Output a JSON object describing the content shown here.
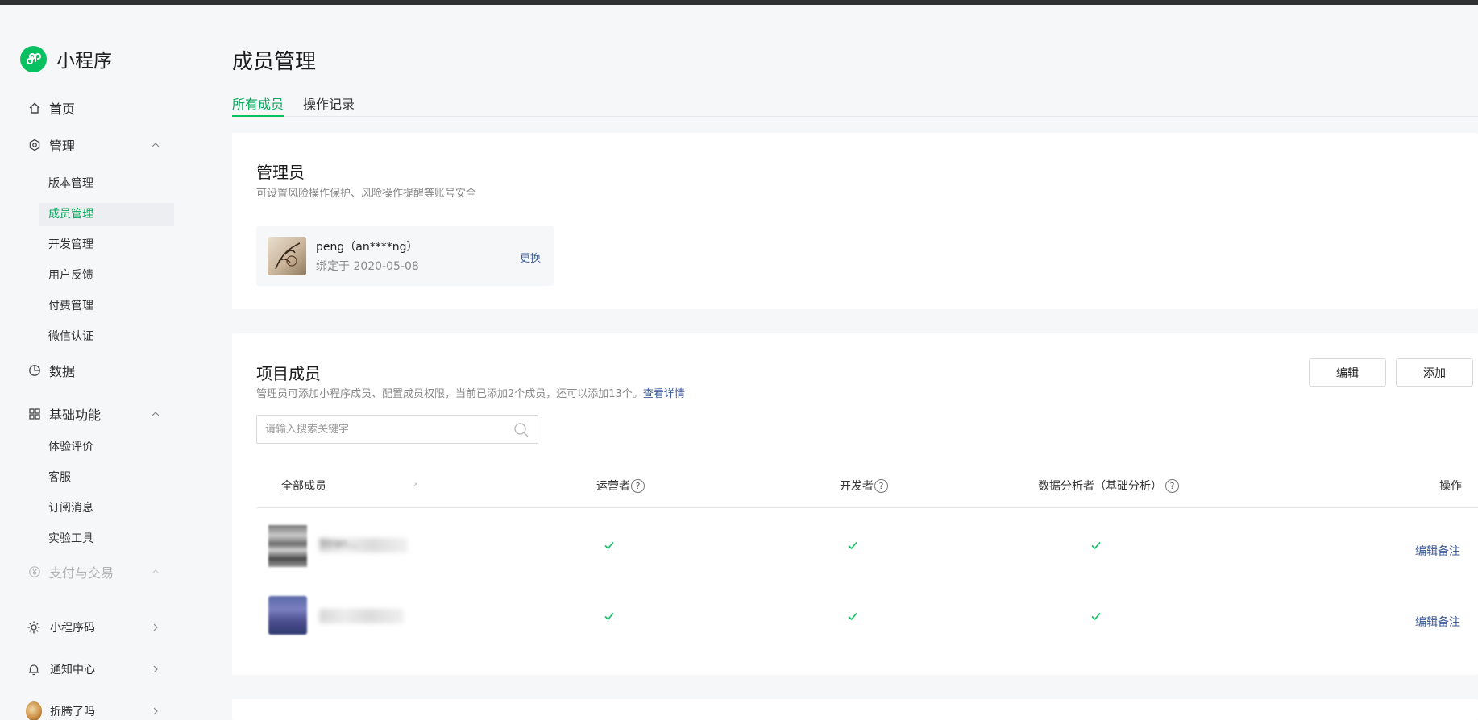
{
  "app": {
    "name": "小程序",
    "brand_color": "#07c160"
  },
  "sidebar": {
    "home": "首页",
    "manage": {
      "label": "管理",
      "items": [
        "版本管理",
        "成员管理",
        "开发管理",
        "用户反馈",
        "付费管理",
        "微信认证"
      ],
      "active": "成员管理"
    },
    "data": "数据",
    "basic": {
      "label": "基础功能",
      "items": [
        "体验评价",
        "客服",
        "订阅消息",
        "实验工具"
      ]
    },
    "payment": "支付与交易",
    "bottom": {
      "qrcode": "小程序码",
      "notifications": "通知中心",
      "account": "折腾了吗"
    }
  },
  "page": {
    "title": "成员管理",
    "tabs": [
      {
        "label": "所有成员",
        "active": true
      },
      {
        "label": "操作记录",
        "active": false
      }
    ]
  },
  "admin_card": {
    "title": "管理员",
    "description": "可设置风险操作保护、风险操作提醒等账号安全",
    "admin": {
      "name": "peng（an****ng）",
      "bound_date": "绑定于 2020-05-08",
      "change_label": "更换"
    }
  },
  "members_card": {
    "title": "项目成员",
    "description": "管理员可添加小程序成员、配置成员权限，当前已添加2个成员，还可以添加13个。",
    "details_link": "查看详情",
    "edit_button": "编辑",
    "add_button": "添加",
    "search_placeholder": "请输入搜索关键字",
    "columns": {
      "all": "全部成员",
      "operator": "运营者",
      "developer": "开发者",
      "analyst": "数据分析者（基础分析）",
      "actions": "操作"
    },
    "rows": [
      {
        "name": "Stran...",
        "operator": true,
        "developer": true,
        "analyst": true,
        "action": "编辑备注"
      },
      {
        "name": "",
        "operator": true,
        "developer": true,
        "analyst": true,
        "action": "编辑备注"
      }
    ]
  }
}
